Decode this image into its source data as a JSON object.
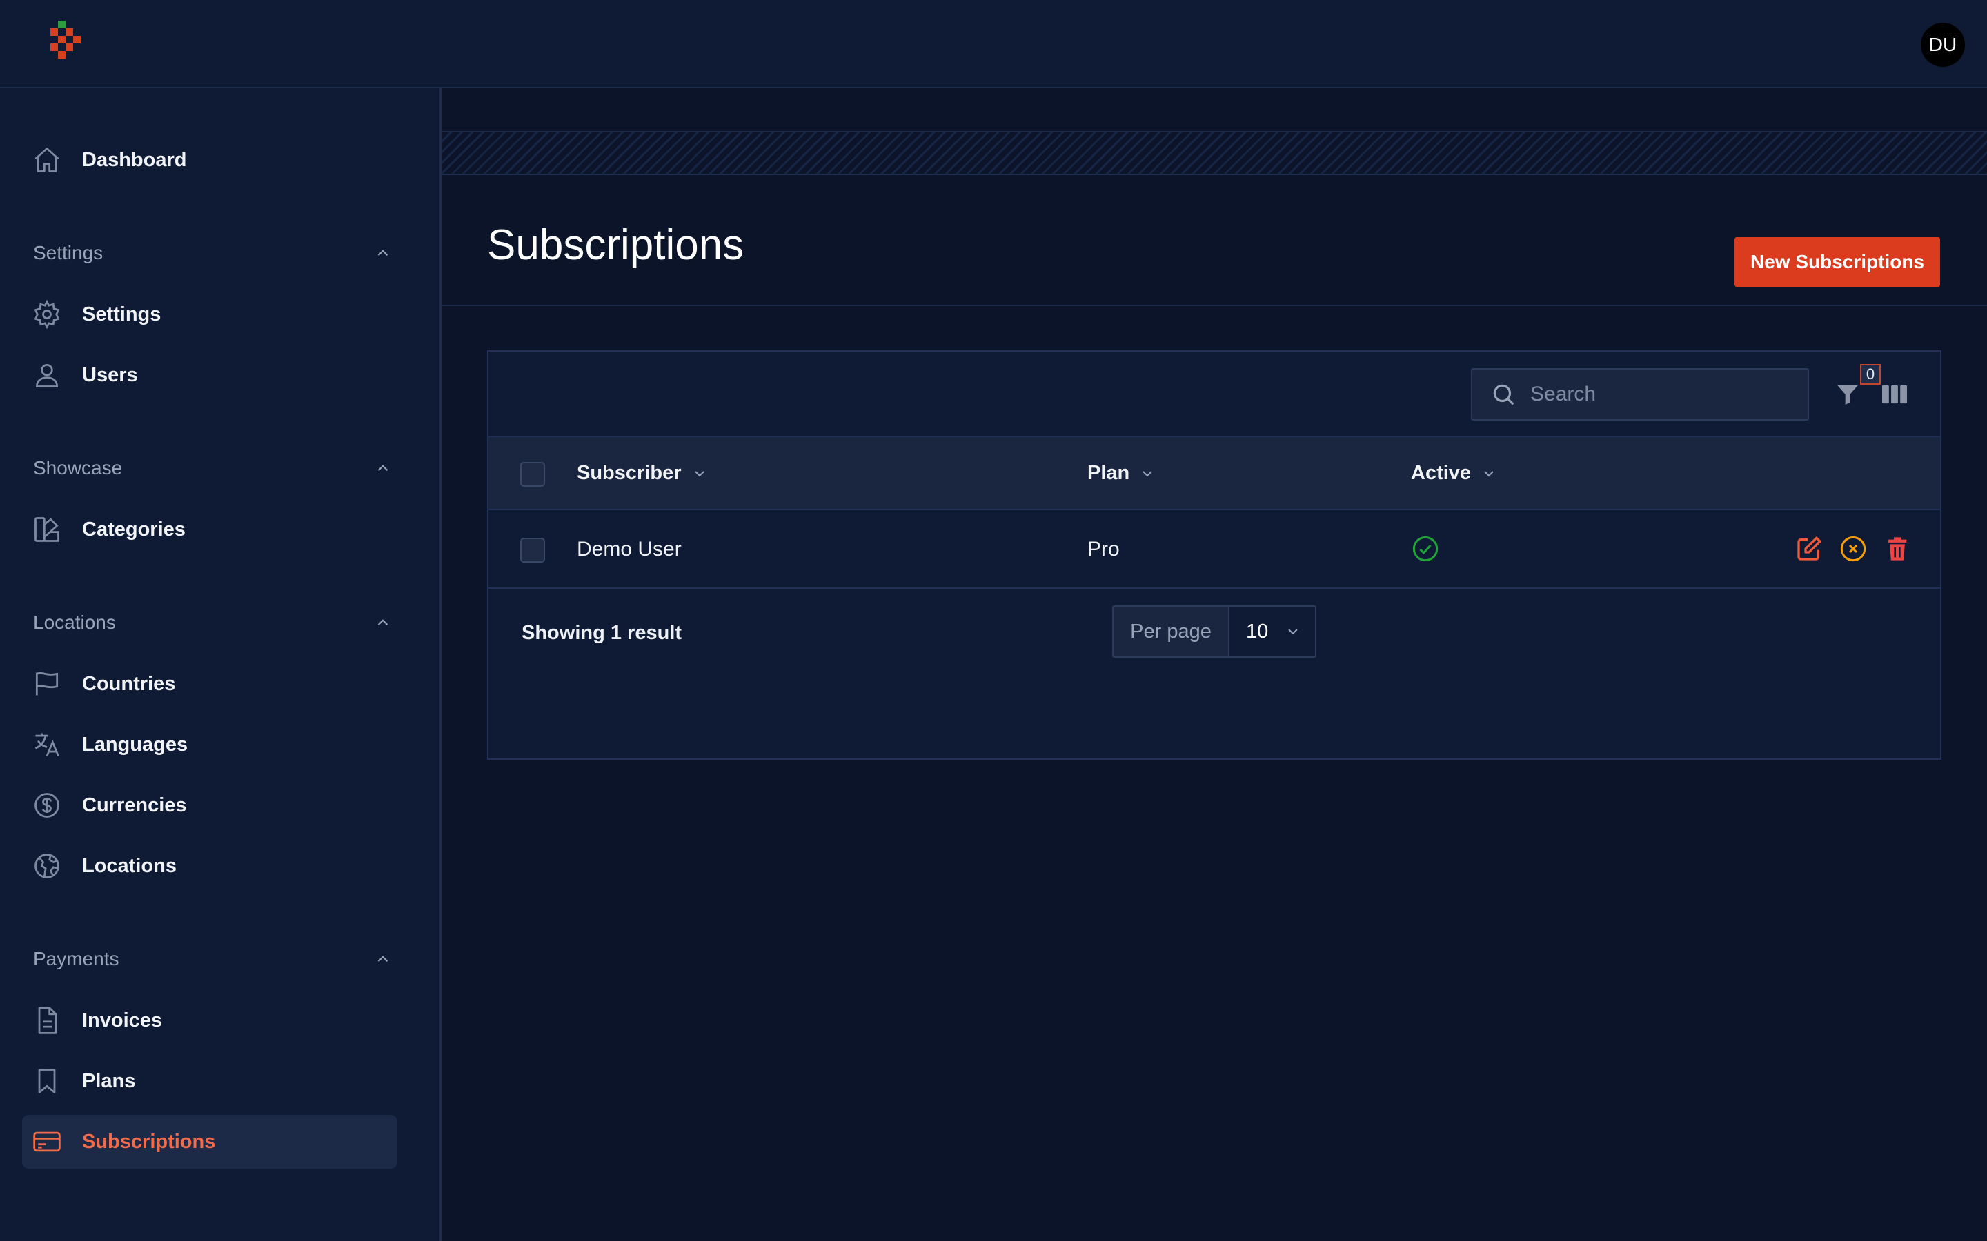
{
  "header": {
    "avatar_initials": "DU"
  },
  "sidebar": {
    "dashboard": {
      "label": "Dashboard",
      "icon": "home-icon"
    },
    "groups": [
      {
        "title": "Settings",
        "items": [
          {
            "label": "Settings",
            "icon": "gear-icon"
          },
          {
            "label": "Users",
            "icon": "user-icon"
          }
        ]
      },
      {
        "title": "Showcase",
        "items": [
          {
            "label": "Categories",
            "icon": "swatch-icon"
          }
        ]
      },
      {
        "title": "Locations",
        "items": [
          {
            "label": "Countries",
            "icon": "flag-icon"
          },
          {
            "label": "Languages",
            "icon": "translate-icon"
          },
          {
            "label": "Currencies",
            "icon": "dollar-icon"
          },
          {
            "label": "Locations",
            "icon": "globe-icon"
          }
        ]
      },
      {
        "title": "Payments",
        "items": [
          {
            "label": "Invoices",
            "icon": "document-icon"
          },
          {
            "label": "Plans",
            "icon": "bookmark-icon"
          },
          {
            "label": "Subscriptions",
            "icon": "credit-card-icon",
            "active": true
          }
        ]
      }
    ]
  },
  "main": {
    "title": "Subscriptions",
    "new_button": "New Subscriptions",
    "search_placeholder": "Search",
    "filter_count": "0",
    "columns": [
      "Subscriber",
      "Plan",
      "Active"
    ],
    "rows": [
      {
        "subscriber": "Demo User",
        "plan": "Pro",
        "active": true
      }
    ],
    "footer": {
      "showing": "Showing 1 result",
      "per_page_label": "Per page",
      "per_page_value": "10"
    }
  },
  "colors": {
    "accent": "#dc3c1e",
    "active_nav": "#f26b4b",
    "success": "#22a33a",
    "warning": "#f59e0b",
    "danger": "#ef4444"
  }
}
